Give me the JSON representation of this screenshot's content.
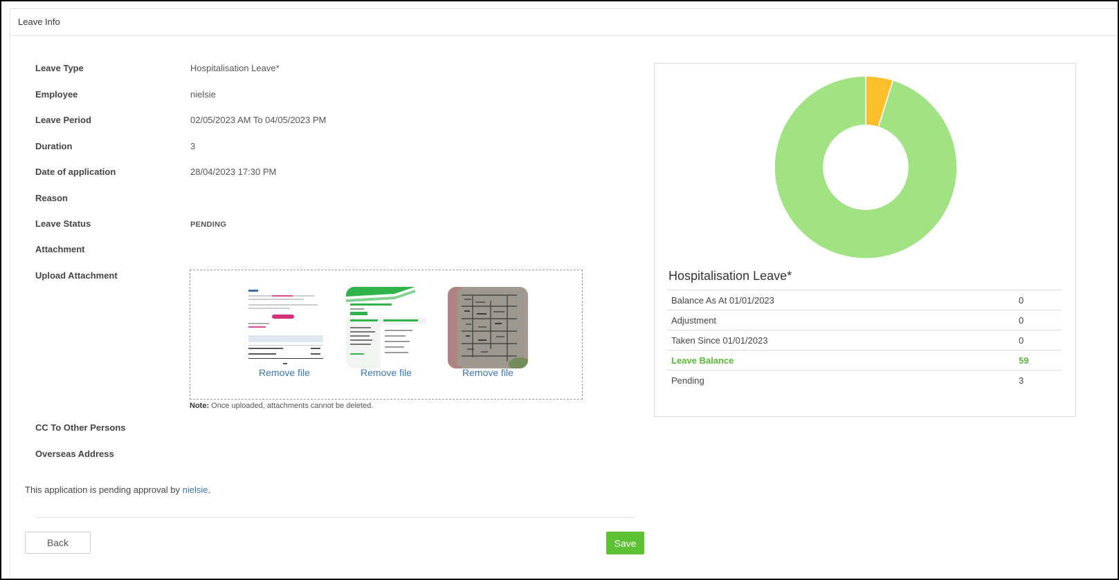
{
  "header": {
    "title": "Leave Info"
  },
  "details": [
    {
      "label": "Leave Type",
      "value": "Hospitalisation Leave*"
    },
    {
      "label": "Employee",
      "value": "nielsie"
    },
    {
      "label": "Leave Period",
      "value": "02/05/2023 AM To 04/05/2023 PM"
    },
    {
      "label": "Duration",
      "value": "3"
    },
    {
      "label": "Date of application",
      "value": "28/04/2023 17:30 PM"
    },
    {
      "label": "Reason",
      "value": ""
    },
    {
      "label": "Leave Status",
      "value": "PENDING"
    },
    {
      "label": "Attachment",
      "value": ""
    },
    {
      "label": "Upload Attachment",
      "value": ""
    }
  ],
  "upload": {
    "remove_label": "Remove file",
    "note_prefix": "Note:",
    "note_text": " Once uploaded, attachments cannot be deleted."
  },
  "extra_fields": [
    {
      "label": "CC To Other Persons"
    },
    {
      "label": "Overseas Address"
    }
  ],
  "pending": {
    "text": "This application is pending approval by ",
    "approver": "nielsie",
    "suffix": "."
  },
  "buttons": {
    "back": "Back",
    "save": "Save"
  },
  "summary": {
    "title": "Hospitalisation Leave*",
    "rows": [
      {
        "label": "Balance As At 01/01/2023",
        "value": "0"
      },
      {
        "label": "Adjustment",
        "value": "0"
      },
      {
        "label": "Taken Since 01/01/2023",
        "value": "0"
      },
      {
        "label": "Leave Balance",
        "value": "59"
      },
      {
        "label": "Pending",
        "value": "3"
      }
    ]
  },
  "chart_data": {
    "type": "pie",
    "categories": [
      "Pending",
      "Leave Balance"
    ],
    "values": [
      3,
      59
    ],
    "colors": [
      "#fbbf2c",
      "#a1e383"
    ],
    "donut": true
  }
}
